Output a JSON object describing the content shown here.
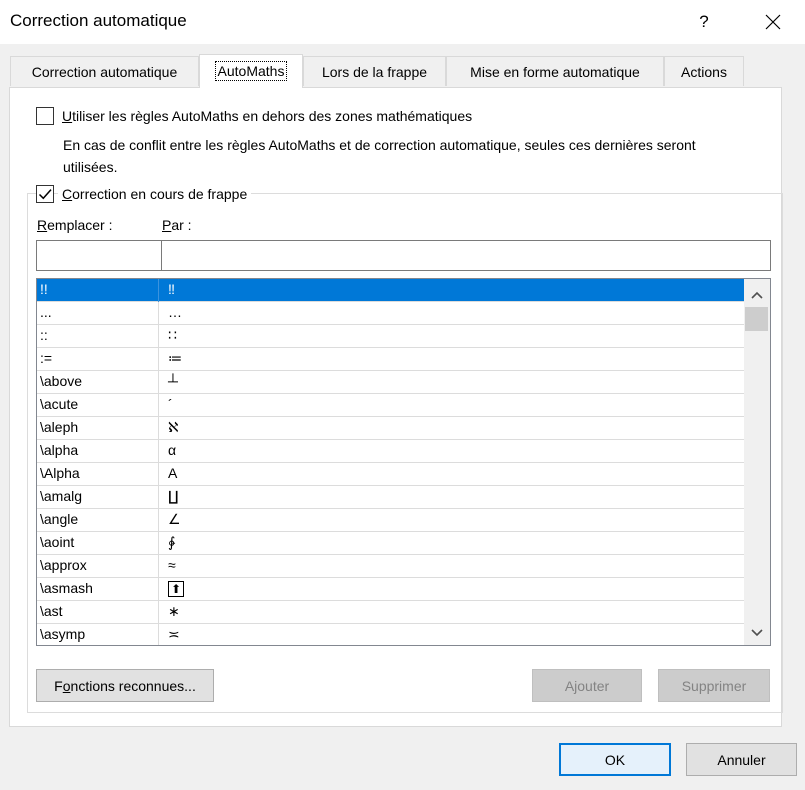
{
  "window": {
    "title": "Correction automatique",
    "help_label": "?"
  },
  "tabs": [
    {
      "label": "Correction automatique"
    },
    {
      "label": "AutoMaths"
    },
    {
      "label": "Lors de la frappe"
    },
    {
      "label": "Mise en forme automatique"
    },
    {
      "label": "Actions"
    }
  ],
  "options": {
    "outside_math": {
      "mnemonic": "U",
      "rest": "tiliser les règles AutoMaths en dehors des zones mathématiques",
      "checked": false
    },
    "conflict_note_line1": "En cas de conflit entre les règles AutoMaths et de correction automatique, seules ces dernières seront",
    "conflict_note_line2": "utilisées.",
    "replace_as_type": {
      "mnemonic": "C",
      "rest": "orrection en cours de frappe",
      "checked": true
    }
  },
  "fields": {
    "replace_label_mnemonic": "R",
    "replace_label_rest": "emplacer :",
    "with_label_mnemonic": "P",
    "with_label_rest": "ar :",
    "replace_value": "",
    "with_value": ""
  },
  "list": {
    "rows": [
      {
        "name": "!!",
        "symbol": "‼"
      },
      {
        "name": "...",
        "symbol": "…"
      },
      {
        "name": "::",
        "symbol": "∷"
      },
      {
        "name": ":=",
        "symbol": "≔"
      },
      {
        "name": "\\above",
        "symbol": "┴"
      },
      {
        "name": "\\acute",
        "symbol": "´"
      },
      {
        "name": "\\aleph",
        "symbol": "ℵ"
      },
      {
        "name": "\\alpha",
        "symbol": "α"
      },
      {
        "name": "\\Alpha",
        "symbol": "Α"
      },
      {
        "name": "\\amalg",
        "symbol": "∐"
      },
      {
        "name": "\\angle",
        "symbol": "∠"
      },
      {
        "name": "\\aoint",
        "symbol": "∳"
      },
      {
        "name": "\\approx",
        "symbol": "≈"
      },
      {
        "name": "\\asmash",
        "symbol": "⬆"
      },
      {
        "name": "\\ast",
        "symbol": "∗"
      },
      {
        "name": "\\asymp",
        "symbol": "≍"
      }
    ],
    "selected_index": 0
  },
  "buttons": {
    "functions_mnemonic": "o",
    "functions_pre": "F",
    "functions_post": "nctions reconnues...",
    "add": "Ajouter",
    "delete": "Supprimer",
    "ok": "OK",
    "cancel": "Annuler"
  },
  "colors": {
    "selection": "#0078d7",
    "default_button_border": "#0078d7"
  }
}
